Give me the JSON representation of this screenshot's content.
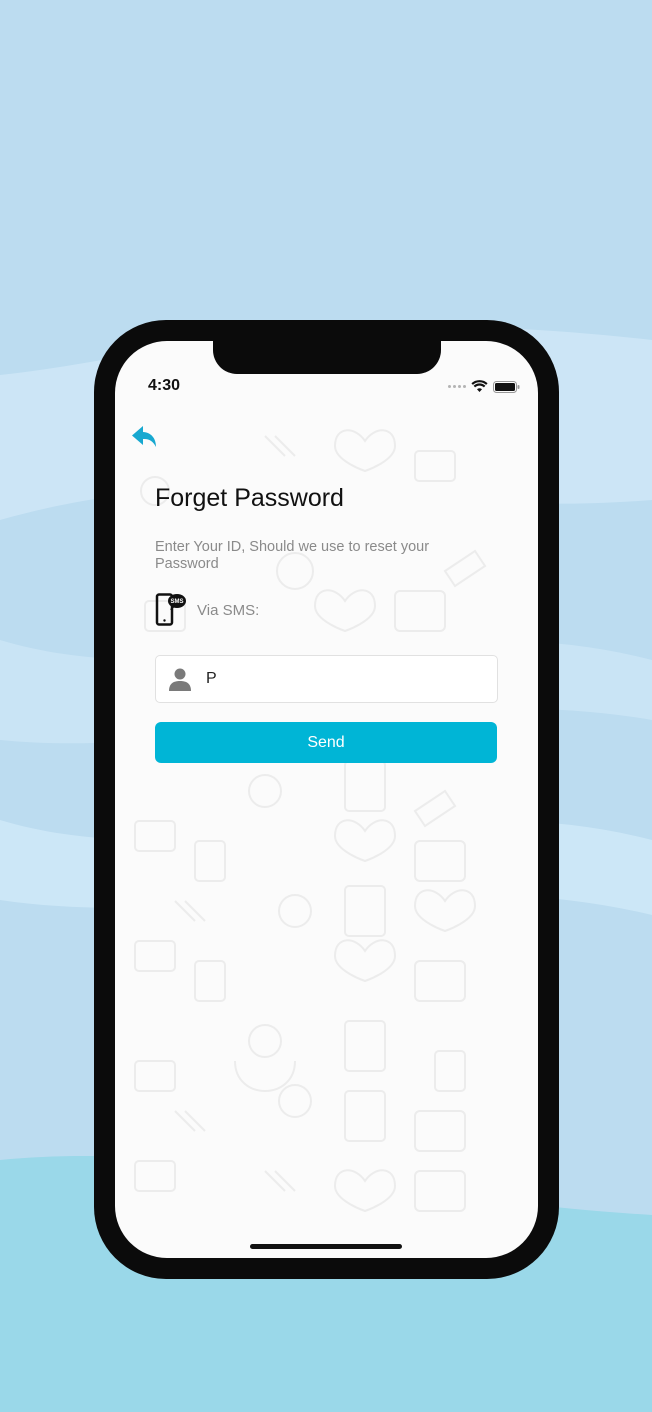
{
  "status_bar": {
    "time": "4:30"
  },
  "screen": {
    "title": "Forget Password",
    "subtitle": "Enter Your ID, Should we use to reset your Password",
    "method_label": "Via SMS:",
    "sms_badge": "SMS",
    "input": {
      "value": "P",
      "placeholder": ""
    },
    "send_label": "Send"
  },
  "icons": {
    "back": "back-arrow-icon",
    "sms": "sms-phone-icon",
    "user": "user-icon",
    "wifi": "wifi-icon",
    "battery": "battery-icon"
  },
  "colors": {
    "accent": "#00b5d6",
    "background": "#bcdcf0",
    "phone_frame": "#0b0b0b",
    "screen_bg": "#fbfbfb"
  }
}
